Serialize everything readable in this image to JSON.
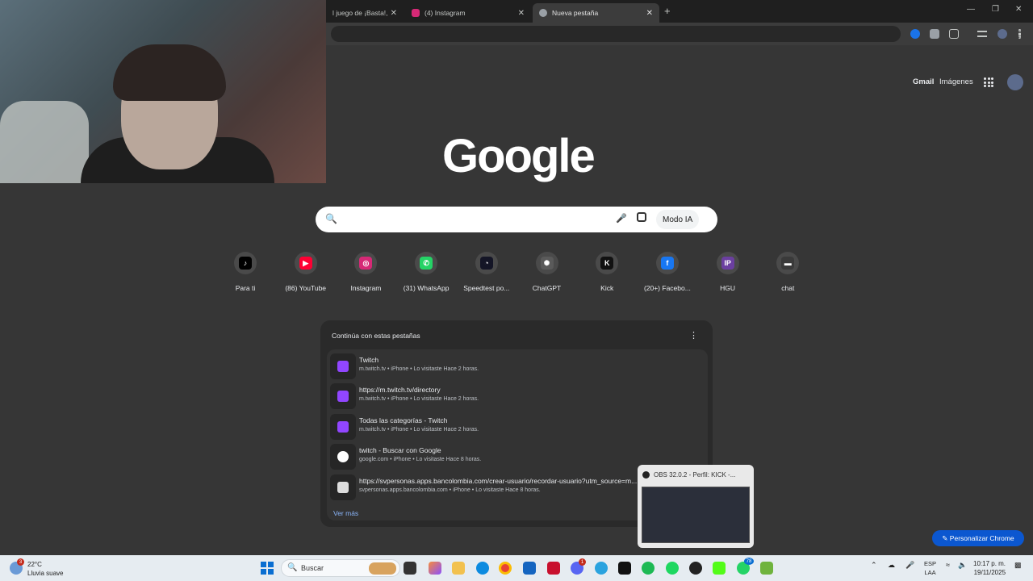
{
  "browser": {
    "tabs": [
      {
        "label": "l juego de ¡Basta!, ¡...",
        "active": false
      },
      {
        "label": "(4) Instagram",
        "active": false
      },
      {
        "label": "Nueva pestaña",
        "active": true
      }
    ],
    "new_tab": "+",
    "close_glyph": "✕",
    "window_controls": {
      "minimize": "—",
      "restore": "❐",
      "close": "✕"
    }
  },
  "page": {
    "top_links": {
      "gmail": "Gmail",
      "images": "Imágenes"
    },
    "logo": "Google",
    "search": {
      "placeholder": "",
      "ai_mode": "Modo IA"
    },
    "shortcuts": [
      {
        "label": "Para ti",
        "icon": "tiktok-icon",
        "glyph": "♪",
        "color": "#000000"
      },
      {
        "label": "(86) YouTube",
        "icon": "youtube-icon",
        "glyph": "▶",
        "color": "#ff0033"
      },
      {
        "label": "Instagram",
        "icon": "instagram-icon",
        "glyph": "◎",
        "color": "#d62976"
      },
      {
        "label": "(31) WhatsApp",
        "icon": "whatsapp-icon",
        "glyph": "✆",
        "color": "#25d366"
      },
      {
        "label": "Speedtest po...",
        "icon": "speedtest-icon",
        "glyph": "◔",
        "color": "#141526"
      },
      {
        "label": "ChatGPT",
        "icon": "chatgpt-icon",
        "glyph": "✺",
        "color": "#5a5a5a"
      },
      {
        "label": "Kick",
        "icon": "kick-icon",
        "glyph": "K",
        "color": "#111111"
      },
      {
        "label": "(20+) Facebo...",
        "icon": "facebook-icon",
        "glyph": "f",
        "color": "#1877f2"
      },
      {
        "label": "HGU",
        "icon": "hgu-icon",
        "glyph": "IP",
        "color": "#6b3fa0"
      },
      {
        "label": "chat",
        "icon": "chat-icon",
        "glyph": "▬",
        "color": "#3a3a3a"
      }
    ],
    "continue_card": {
      "title": "Continúa con estas pestañas",
      "menu": "⋮",
      "items": [
        {
          "title": "Twitch",
          "subtitle": "m.twitch.tv • iPhone • Lo visitaste Hace 2 horas.",
          "icon": "twitch-icon",
          "color": "#9146ff"
        },
        {
          "title": "https://m.twitch.tv/directory",
          "subtitle": "m.twitch.tv • iPhone • Lo visitaste Hace 2 horas.",
          "icon": "twitch-icon",
          "color": "#9146ff"
        },
        {
          "title": "Todas las categorías - Twitch",
          "subtitle": "m.twitch.tv • iPhone • Lo visitaste Hace 2 horas.",
          "icon": "twitch-icon",
          "color": "#9146ff"
        },
        {
          "title": "twitch - Buscar con Google",
          "subtitle": "google.com • iPhone • Lo visitaste Hace 8 horas.",
          "icon": "google-icon",
          "color": "#ffffff"
        },
        {
          "title": "https://svpersonas.apps.bancolombia.com/crear-usuario/recordar-usuario?utm_source=m...",
          "subtitle": "svpersonas.apps.bancolombia.com • iPhone • Lo visitaste Hace 8 horas.",
          "icon": "bancolombia-icon",
          "color": "#dddddd"
        }
      ],
      "more": "Ver más"
    },
    "customize_button": "✎  Personalizar Chrome"
  },
  "obs_popup": {
    "title": "OBS 32.0.2 - Perfil: KICK -..."
  },
  "taskbar": {
    "weather": {
      "temp": "22°C",
      "desc": "Lluvia suave",
      "badge": "3"
    },
    "search_label": "Buscar",
    "discord_badge": "1",
    "whatsapp_badge": "78",
    "tray": {
      "chevron": "⌃",
      "lang_top": "ESP",
      "lang_bottom": "LAA"
    },
    "clock": {
      "time": "10:17 p. m.",
      "date": "19/11/2025"
    }
  }
}
